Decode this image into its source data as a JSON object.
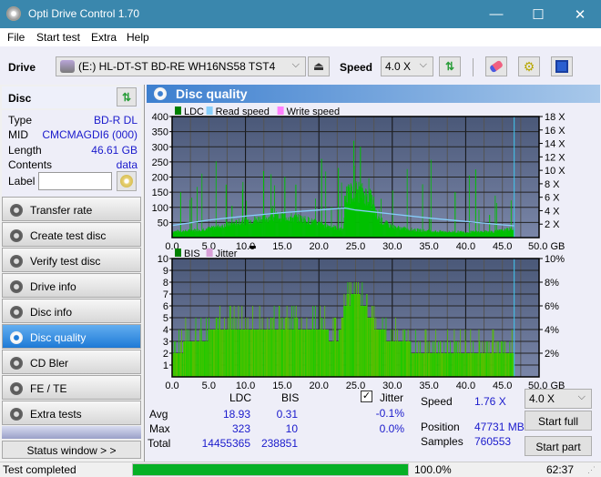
{
  "window": {
    "title": "Opti Drive Control 1.70",
    "minimize": "—",
    "maximize": "☐",
    "close": "✕"
  },
  "menu": [
    "File",
    "Start test",
    "Extra",
    "Help"
  ],
  "toolbar": {
    "drive_label": "Drive",
    "drive_value": "(E:)  HL-DT-ST BD-RE  WH16NS58 TST4",
    "speed_label": "Speed",
    "speed_value": "4.0 X"
  },
  "disc": {
    "header": "Disc",
    "type_label": "Type",
    "type": "BD-R DL",
    "mid_label": "MID",
    "mid": "CMCMAGDI6 (000)",
    "length_label": "Length",
    "length": "46.61 GB",
    "contents_label": "Contents",
    "contents": "data",
    "label_label": "Label",
    "label_value": ""
  },
  "nav": [
    {
      "label": "Transfer rate"
    },
    {
      "label": "Create test disc"
    },
    {
      "label": "Verify test disc"
    },
    {
      "label": "Drive info"
    },
    {
      "label": "Disc info"
    },
    {
      "label": "Disc quality",
      "active": true
    },
    {
      "label": "CD Bler"
    },
    {
      "label": "FE / TE"
    },
    {
      "label": "Extra tests"
    }
  ],
  "status_window": "Status window > >",
  "panel": {
    "title": "Disc quality"
  },
  "chart_data": [
    {
      "type": "area",
      "title": "LDC",
      "legend": [
        "LDC",
        "Read speed",
        "Write speed"
      ],
      "legend_colors": [
        "#008000",
        "#87cefa",
        "#ff80ff"
      ],
      "xlabel": "GB",
      "xlim": [
        0,
        50
      ],
      "xticks": [
        "0.0",
        "5.0",
        "10.0",
        "15.0",
        "20.0",
        "25.0",
        "30.0",
        "35.0",
        "40.0",
        "45.0",
        "50.0 GB"
      ],
      "ylim": [
        0,
        400
      ],
      "yticks": [
        "50",
        "100",
        "150",
        "200",
        "250",
        "300",
        "350",
        "400"
      ],
      "y2lim": [
        0,
        18
      ],
      "y2ticks": [
        "2 X",
        "4 X",
        "6 X",
        "8 X",
        "10 X",
        "12 X",
        "14 X",
        "16 X",
        "18 X"
      ],
      "ldc_profile_x": [
        0,
        2,
        5,
        8,
        10,
        13,
        15,
        18,
        20,
        22,
        23.3,
        23.5,
        25,
        26,
        27,
        28,
        30,
        33,
        36,
        40,
        44,
        46.6
      ],
      "ldc_profile_y": [
        20,
        22,
        30,
        45,
        55,
        65,
        70,
        60,
        45,
        35,
        25,
        140,
        155,
        145,
        130,
        60,
        35,
        25,
        20,
        18,
        20,
        30
      ],
      "ldc_max": 323,
      "read_speed_x": [
        0,
        5,
        10,
        15,
        20,
        23.5,
        25,
        30,
        35,
        40,
        45,
        46.6
      ],
      "read_speed_y": [
        1.8,
        2.6,
        3.2,
        3.7,
        4.1,
        4.4,
        4.1,
        3.5,
        2.9,
        2.4,
        1.9,
        1.76
      ]
    },
    {
      "type": "area",
      "title": "BIS",
      "legend": [
        "BIS",
        "Jitter"
      ],
      "legend_colors": [
        "#008000",
        "#d8a0d8"
      ],
      "xlabel": "GB",
      "xlim": [
        0,
        50
      ],
      "xticks": [
        "0.0",
        "5.0",
        "10.0",
        "15.0",
        "20.0",
        "25.0",
        "30.0",
        "35.0",
        "40.0",
        "45.0",
        "50.0 GB"
      ],
      "ylim": [
        0,
        10
      ],
      "yticks": [
        "1",
        "2",
        "3",
        "4",
        "5",
        "6",
        "7",
        "8",
        "9",
        "10"
      ],
      "y2ticks": [
        "2%",
        "4%",
        "6%",
        "8%",
        "10%"
      ],
      "bis_profile_x": [
        0,
        3,
        7,
        10,
        15,
        20,
        22.5,
        23.5,
        25,
        26,
        28,
        30,
        35,
        40,
        45,
        46.6
      ],
      "bis_profile_y": [
        2,
        3,
        4,
        4,
        4,
        4,
        3,
        6,
        7,
        6,
        4,
        3,
        2,
        2,
        2,
        2
      ],
      "bis_max": 10
    }
  ],
  "stats": {
    "col_ldc": "LDC",
    "col_bis": "BIS",
    "avg_label": "Avg",
    "avg_ldc": "18.93",
    "avg_bis": "0.31",
    "max_label": "Max",
    "max_ldc": "323",
    "max_bis": "10",
    "total_label": "Total",
    "total_ldc": "14455365",
    "total_bis": "238851",
    "jitter_label": "Jitter",
    "jitter_checked": true,
    "jitter_avg": "-0.1%",
    "jitter_max": "0.0%",
    "speed_label": "Speed",
    "speed": "1.76 X",
    "position_label": "Position",
    "position": "47731 MB",
    "samples_label": "Samples",
    "samples": "760553",
    "speed_select": "4.0 X",
    "start_full": "Start full",
    "start_part": "Start part"
  },
  "statusbar": {
    "text": "Test completed",
    "progress": 100.0,
    "progress_text": "100.0%",
    "time": "62:37"
  }
}
